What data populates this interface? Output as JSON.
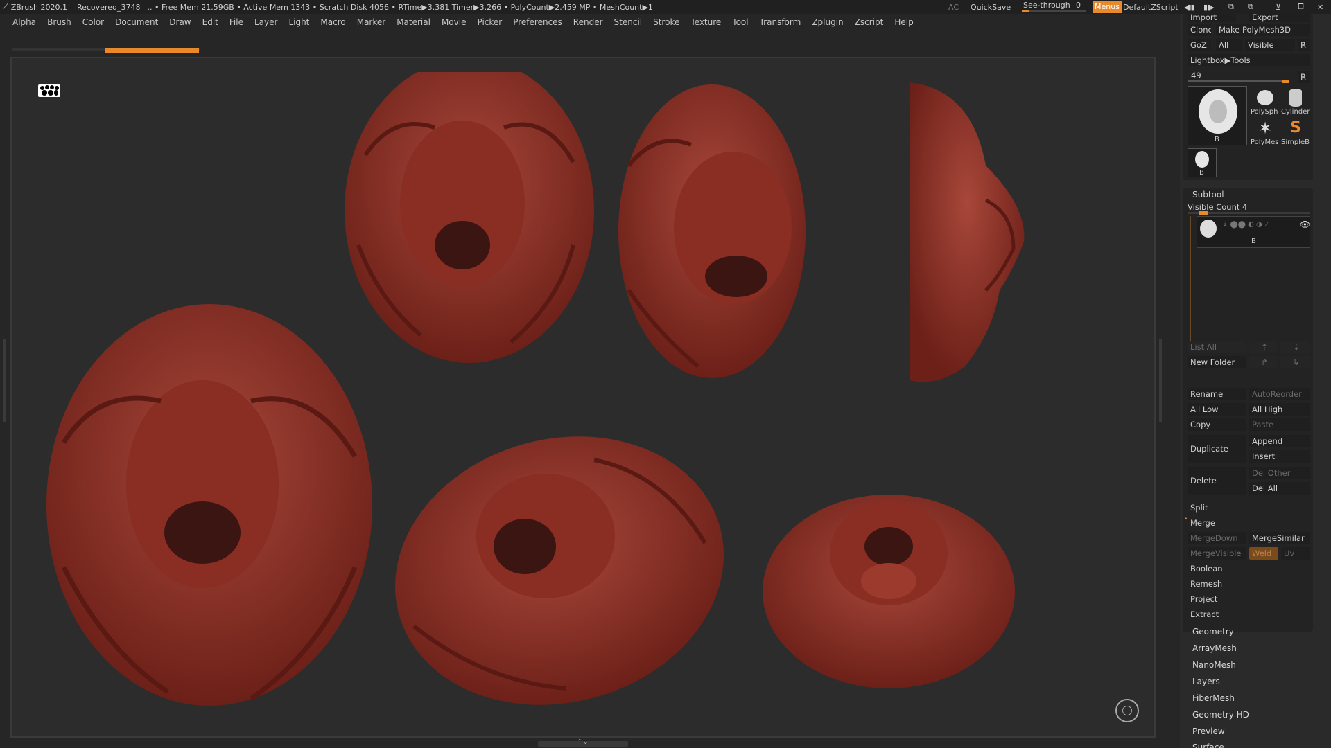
{
  "topbar": {
    "app": "ZBrush 2020.1",
    "doc": "Recovered_3748",
    "stats": ".. • Free Mem 21.59GB • Active Mem 1343 • Scratch Disk 4056 • RTime▶3.381 Timer▶3.266 • PolyCount▶2.459 MP • MeshCount▶1",
    "ac": "AC",
    "quicksave": "QuickSave",
    "seethrough": "See-through",
    "seethrough_value": "0",
    "menus": "Menus",
    "script": "DefaultZScript"
  },
  "menus": [
    "Alpha",
    "Brush",
    "Color",
    "Document",
    "Draw",
    "Edit",
    "File",
    "Layer",
    "Light",
    "Macro",
    "Marker",
    "Material",
    "Movie",
    "Picker",
    "Preferences",
    "Render",
    "Stencil",
    "Stroke",
    "Texture",
    "Tool",
    "Transform",
    "Zplugin",
    "Zscript",
    "Help"
  ],
  "tool": {
    "import": "Import",
    "export": "Export",
    "clone": "Clone",
    "make_polymesh": "Make PolyMesh3D",
    "goz": "GoZ",
    "all": "All",
    "visible": "Visible",
    "r": "R",
    "lightbox": "Lightbox▶Tools",
    "count": "49",
    "thumb_b": "B",
    "polysph": "PolySph",
    "cylinder": "Cylinder",
    "polymes": "PolyMes",
    "simpleb": "SimpleB"
  },
  "subtool": {
    "title": "Subtool",
    "visible_count": "Visible Count 4",
    "item_b": "B",
    "list_all": "List All",
    "new_folder": "New Folder",
    "rename": "Rename",
    "autoreorder": "AutoReorder",
    "all_low": "All Low",
    "all_high": "All High",
    "copy": "Copy",
    "paste": "Paste",
    "duplicate": "Duplicate",
    "append": "Append",
    "insert": "Insert",
    "delete": "Delete",
    "del_other": "Del Other",
    "del_all": "Del All",
    "split": "Split",
    "merge": "Merge",
    "mergedown": "MergeDown",
    "mergesimilar": "MergeSimilar",
    "mergevisible": "MergeVisible",
    "weld": "Weld",
    "uv": "Uv",
    "boolean": "Boolean",
    "remesh": "Remesh",
    "project": "Project",
    "extract": "Extract"
  },
  "palettes": [
    "Geometry",
    "ArrayMesh",
    "NanoMesh",
    "Layers",
    "FiberMesh",
    "Geometry HD",
    "Preview",
    "Surface"
  ],
  "colors": {
    "accent": "#e8892c",
    "clay": "#8f2e22"
  }
}
